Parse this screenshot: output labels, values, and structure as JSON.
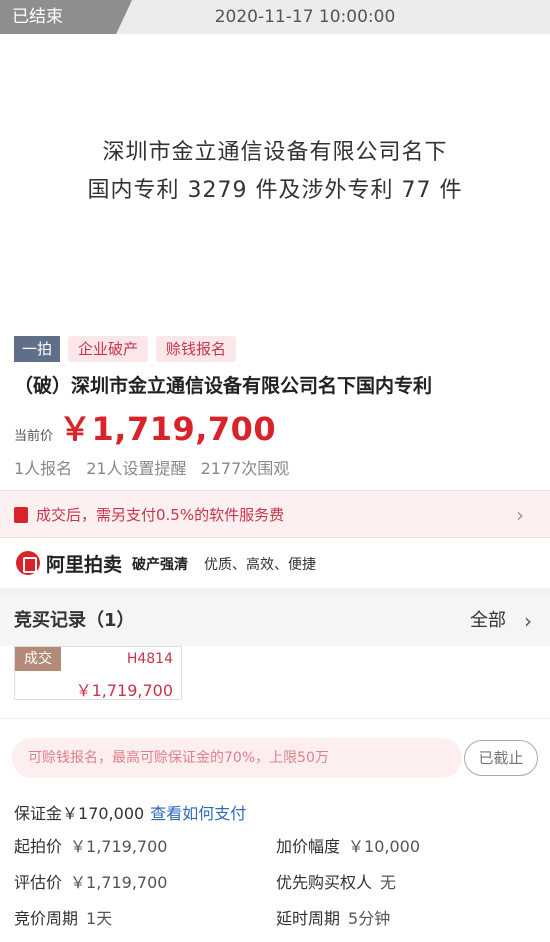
{
  "header": {
    "status": "已结束",
    "time": "2020-11-17 10:00:00"
  },
  "banner": {
    "line1": "深圳市金立通信设备有限公司名下",
    "line2": "国内专利 3279 件及涉外专利 77 件"
  },
  "tags": {
    "round": "一拍",
    "t1": "企业破产",
    "t2": "赊钱报名"
  },
  "item": {
    "title": "（破）深圳市金立通信设备有限公司名下国内专利",
    "price_label": "当前价",
    "price": "￥1,719,700",
    "stat1": "1人报名",
    "stat2": "21人设置提醒",
    "stat3": "2177次围观"
  },
  "notice": {
    "text": "成交后，需另支付0.5%的软件服务费",
    "chevron": "›"
  },
  "brand": {
    "name": "阿里拍卖",
    "sub": "破产强清",
    "sub2": "优质、高效、便捷"
  },
  "records": {
    "title": "竞买记录（1）",
    "all": "全部",
    "chevron": "›",
    "bid": {
      "status": "成交",
      "user": "H4814",
      "price": "￥1,719,700"
    }
  },
  "loan": {
    "text": "可赊钱报名，最高可赊保证金的70%，上限50万",
    "button": "已截止"
  },
  "deposit": {
    "label": "保证金",
    "value": "￥170,000",
    "link": "查看如何支付"
  },
  "info": {
    "start_label": "起拍价",
    "start_val": "￥1,719,700",
    "inc_label": "加价幅度",
    "inc_val": "￥10,000",
    "eval_label": "评估价",
    "eval_val": "￥1,719,700",
    "prio_label": "优先购买权人",
    "prio_val": "无",
    "cycle_label": "竞价周期",
    "cycle_val": "1天",
    "delay_label": "延时周期",
    "delay_val": "5分钟"
  }
}
